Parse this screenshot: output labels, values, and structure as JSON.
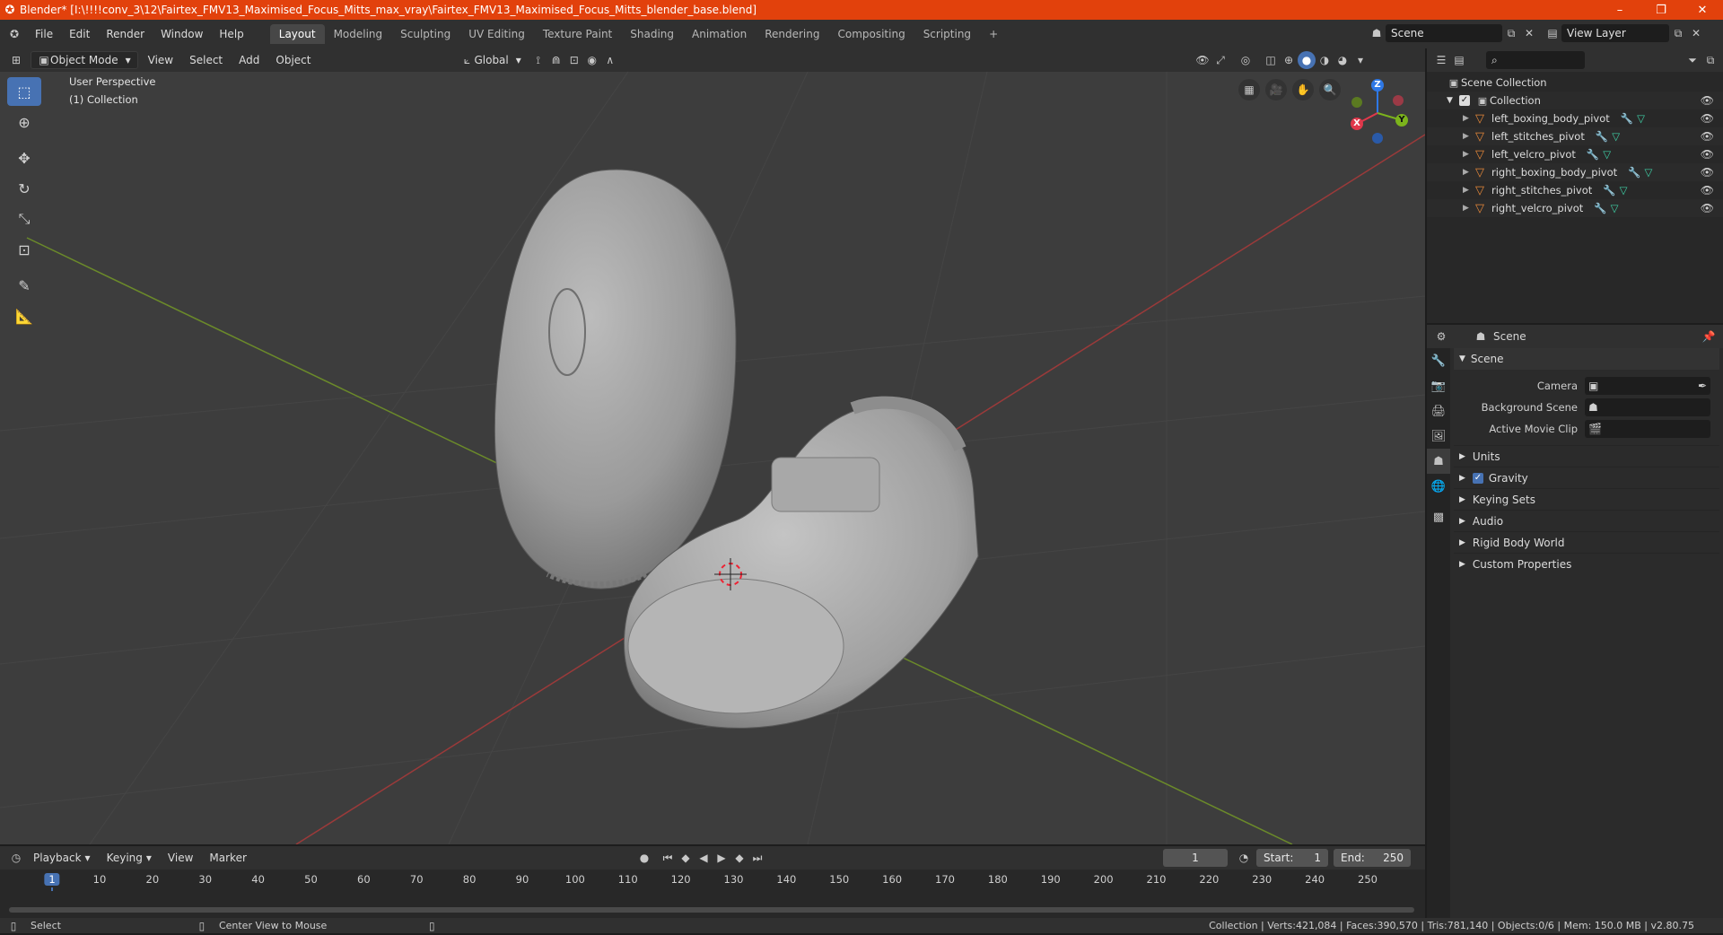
{
  "window": {
    "title": "Blender* [I:\\!!!!conv_3\\12\\Fairtex_FMV13_Maximised_Focus_Mitts_max_vray\\Fairtex_FMV13_Maximised_Focus_Mitts_blender_base.blend]",
    "minimize": "–",
    "maximize": "❐",
    "close": "✕"
  },
  "menu": [
    "File",
    "Edit",
    "Render",
    "Window",
    "Help"
  ],
  "workspaces": [
    "Layout",
    "Modeling",
    "Sculpting",
    "UV Editing",
    "Texture Paint",
    "Shading",
    "Animation",
    "Rendering",
    "Compositing",
    "Scripting"
  ],
  "workspace_add": "+",
  "scene_name": "Scene",
  "view_layer": "View Layer",
  "viewport_header": {
    "mode": "Object Mode",
    "menus": [
      "View",
      "Select",
      "Add",
      "Object"
    ],
    "transform_orientation": "Global"
  },
  "viewport": {
    "perspective_label": "User Perspective",
    "collection_label": "(1) Collection",
    "gizmo": {
      "x": "X",
      "y": "Y",
      "z": "Z"
    }
  },
  "outliner": {
    "root": "Scene Collection",
    "collection": "Collection",
    "items": [
      {
        "name": "left_boxing_body_pivot"
      },
      {
        "name": "left_stitches_pivot"
      },
      {
        "name": "left_velcro_pivot"
      },
      {
        "name": "right_boxing_body_pivot"
      },
      {
        "name": "right_stitches_pivot"
      },
      {
        "name": "right_velcro_pivot"
      }
    ]
  },
  "properties": {
    "header": "Scene",
    "section": "Scene",
    "camera_label": "Camera",
    "background_label": "Background Scene",
    "movie_clip_label": "Active Movie Clip",
    "subsections": [
      "Units",
      "Gravity",
      "Keying Sets",
      "Audio",
      "Rigid Body World",
      "Custom Properties"
    ],
    "gravity_checked": true
  },
  "timeline": {
    "menus": [
      "Playback",
      "Keying",
      "View",
      "Marker"
    ],
    "current_frame": "1",
    "start_label": "Start:",
    "start": "1",
    "end_label": "End:",
    "end": "250",
    "ticks": [
      "1",
      "10",
      "20",
      "30",
      "40",
      "50",
      "60",
      "70",
      "80",
      "90",
      "100",
      "110",
      "120",
      "130",
      "140",
      "150",
      "160",
      "170",
      "180",
      "190",
      "200",
      "210",
      "220",
      "230",
      "240",
      "250"
    ]
  },
  "status": {
    "left": "Select",
    "middle": "Center View to Mouse",
    "right": "Collection | Verts:421,084 | Faces:390,570 | Tris:781,140 | Objects:0/6 | Mem: 150.0 MB | v2.80.75"
  },
  "colors": {
    "accent": "#4772b3",
    "titlebar": "#e2410c",
    "object_icon": "#e8893a",
    "modifier_icon": "#6ea6e4",
    "mesh_icon": "#3fd0a6"
  }
}
